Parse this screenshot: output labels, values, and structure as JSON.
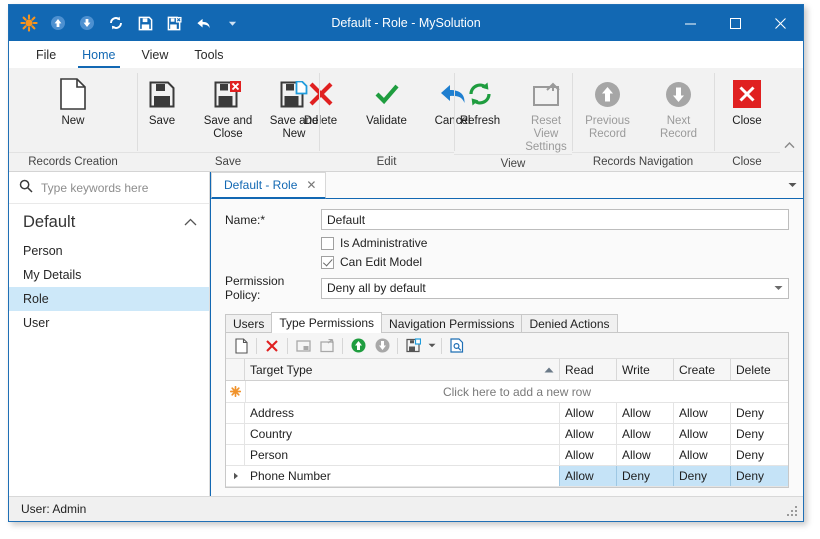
{
  "window": {
    "title": "Default - Role - MySolution",
    "minimize_label": "—",
    "maximize_label": "☐",
    "close_label": "✕"
  },
  "quick_access": [
    {
      "name": "app-logo-icon",
      "label": "MySolution"
    },
    {
      "name": "previous-record-icon",
      "label": "Previous Record"
    },
    {
      "name": "next-record-icon",
      "label": "Next Record"
    },
    {
      "name": "refresh-icon",
      "label": "Refresh"
    },
    {
      "name": "save-icon",
      "label": "Save"
    },
    {
      "name": "save-and-close-icon",
      "label": "Save and Close"
    },
    {
      "name": "undo-icon",
      "label": "Cancel"
    },
    {
      "name": "customize-quick-access-icon",
      "label": "Customize Quick Access Toolbar"
    }
  ],
  "ribbon": {
    "tabs": [
      {
        "label": "File",
        "active": false
      },
      {
        "label": "Home",
        "active": true
      },
      {
        "label": "View",
        "active": false
      },
      {
        "label": "Tools",
        "active": false
      }
    ],
    "collapse_label": "⌃",
    "groups": [
      {
        "label": "Records Creation",
        "buttons": [
          {
            "label": "New",
            "icon": "new-document-icon",
            "disabled": false
          }
        ]
      },
      {
        "label": "Save",
        "buttons": [
          {
            "label": "Save",
            "icon": "save-icon",
            "disabled": false
          },
          {
            "label": "Save and Close",
            "icon": "save-and-close-icon",
            "disabled": false
          },
          {
            "label": "Save and New",
            "icon": "save-and-new-icon",
            "disabled": false
          }
        ]
      },
      {
        "label": "Edit",
        "buttons": [
          {
            "label": "Delete",
            "icon": "delete-icon",
            "disabled": false
          },
          {
            "label": "Validate",
            "icon": "validate-check-icon",
            "disabled": false
          },
          {
            "label": "Cancel",
            "icon": "cancel-undo-arrow-icon",
            "disabled": false
          }
        ]
      },
      {
        "label": "View",
        "buttons": [
          {
            "label": "Refresh",
            "icon": "refresh-icon",
            "disabled": false
          },
          {
            "label": "Reset View Settings",
            "icon": "reset-view-settings-icon",
            "disabled": true
          }
        ]
      },
      {
        "label": "Records Navigation",
        "buttons": [
          {
            "label": "Previous Record",
            "icon": "previous-record-icon",
            "disabled": true
          },
          {
            "label": "Next Record",
            "icon": "next-record-icon",
            "disabled": true
          }
        ]
      },
      {
        "label": "Close",
        "buttons": [
          {
            "label": "Close",
            "icon": "close-x-icon",
            "disabled": false
          }
        ]
      }
    ]
  },
  "sidebar": {
    "search": {
      "placeholder": "Type keywords here",
      "value": "",
      "icon": "search-icon"
    },
    "group": {
      "label": "Default",
      "collapse_icon": "chevron-up-icon"
    },
    "items": [
      {
        "label": "Person",
        "selected": false
      },
      {
        "label": "My Details",
        "selected": false
      },
      {
        "label": "Role",
        "selected": true
      },
      {
        "label": "User",
        "selected": false
      }
    ]
  },
  "document_tabs": {
    "tabs": [
      {
        "label": "Default - Role",
        "close_label": "✕",
        "active": true
      }
    ],
    "overflow_label": "▾"
  },
  "form": {
    "name": {
      "label": "Name:*",
      "value": "Default"
    },
    "is_administrative": {
      "label": "Is Administrative",
      "checked": false
    },
    "can_edit_model": {
      "label": "Can Edit Model",
      "checked": true
    },
    "permission_policy": {
      "label": "Permission Policy:",
      "value": "Deny all by default",
      "arrow": "▾"
    }
  },
  "detail": {
    "tabs": [
      {
        "label": "Users",
        "active": false
      },
      {
        "label": "Type Permissions",
        "active": true
      },
      {
        "label": "Navigation Permissions",
        "active": false
      },
      {
        "label": "Denied Actions",
        "active": false
      }
    ],
    "toolbar": [
      {
        "name": "new-row-icon",
        "label": "New",
        "type": "button"
      },
      {
        "name": "toolbar-separator",
        "label": "",
        "type": "sep"
      },
      {
        "name": "delete-row-icon",
        "label": "Delete",
        "type": "button"
      },
      {
        "name": "toolbar-separator",
        "label": "",
        "type": "sep"
      },
      {
        "name": "inline-edit-icon",
        "label": "Inline Edit",
        "type": "button"
      },
      {
        "name": "open-record-icon",
        "label": "Open Record",
        "type": "button"
      },
      {
        "name": "toolbar-separator",
        "label": "",
        "type": "sep"
      },
      {
        "name": "link-record-icon",
        "label": "Link",
        "type": "button"
      },
      {
        "name": "unlink-record-icon",
        "label": "Unlink",
        "type": "button"
      },
      {
        "name": "toolbar-separator",
        "label": "",
        "type": "sep"
      },
      {
        "name": "export-icon",
        "label": "Export",
        "type": "button"
      },
      {
        "name": "export-dropdown-arrow-icon",
        "label": "▾",
        "type": "arrow"
      },
      {
        "name": "toolbar-separator",
        "label": "",
        "type": "sep"
      },
      {
        "name": "print-preview-icon",
        "label": "Print Preview",
        "type": "button"
      }
    ],
    "grid": {
      "new_row_text": "Click here to add a new row",
      "new_row_icon": "new-row-asterisk-icon",
      "sort_indicator": "▲",
      "row_indicator": "▶",
      "columns": [
        {
          "key": "target_type",
          "label": "Target Type",
          "sorted": "asc"
        },
        {
          "key": "read",
          "label": "Read",
          "sorted": ""
        },
        {
          "key": "write",
          "label": "Write",
          "sorted": ""
        },
        {
          "key": "create",
          "label": "Create",
          "sorted": ""
        },
        {
          "key": "delete",
          "label": "Delete",
          "sorted": ""
        }
      ],
      "rows": [
        {
          "target_type": "Address",
          "read": "Allow",
          "write": "Allow",
          "create": "Allow",
          "delete": "Deny",
          "selected": false
        },
        {
          "target_type": "Country",
          "read": "Allow",
          "write": "Allow",
          "create": "Allow",
          "delete": "Deny",
          "selected": false
        },
        {
          "target_type": "Person",
          "read": "Allow",
          "write": "Allow",
          "create": "Allow",
          "delete": "Deny",
          "selected": false
        },
        {
          "target_type": "Phone Number",
          "read": "Allow",
          "write": "Deny",
          "create": "Deny",
          "delete": "Deny",
          "selected": true
        }
      ]
    }
  },
  "statusbar": {
    "user_text": "User: Admin"
  },
  "colors": {
    "accent": "#1268b3",
    "selection": "#c5e3f7",
    "sidebar_selection": "#cde8f9",
    "danger": "#e02020",
    "success": "#1f9d3f",
    "orange": "#f0922b"
  }
}
